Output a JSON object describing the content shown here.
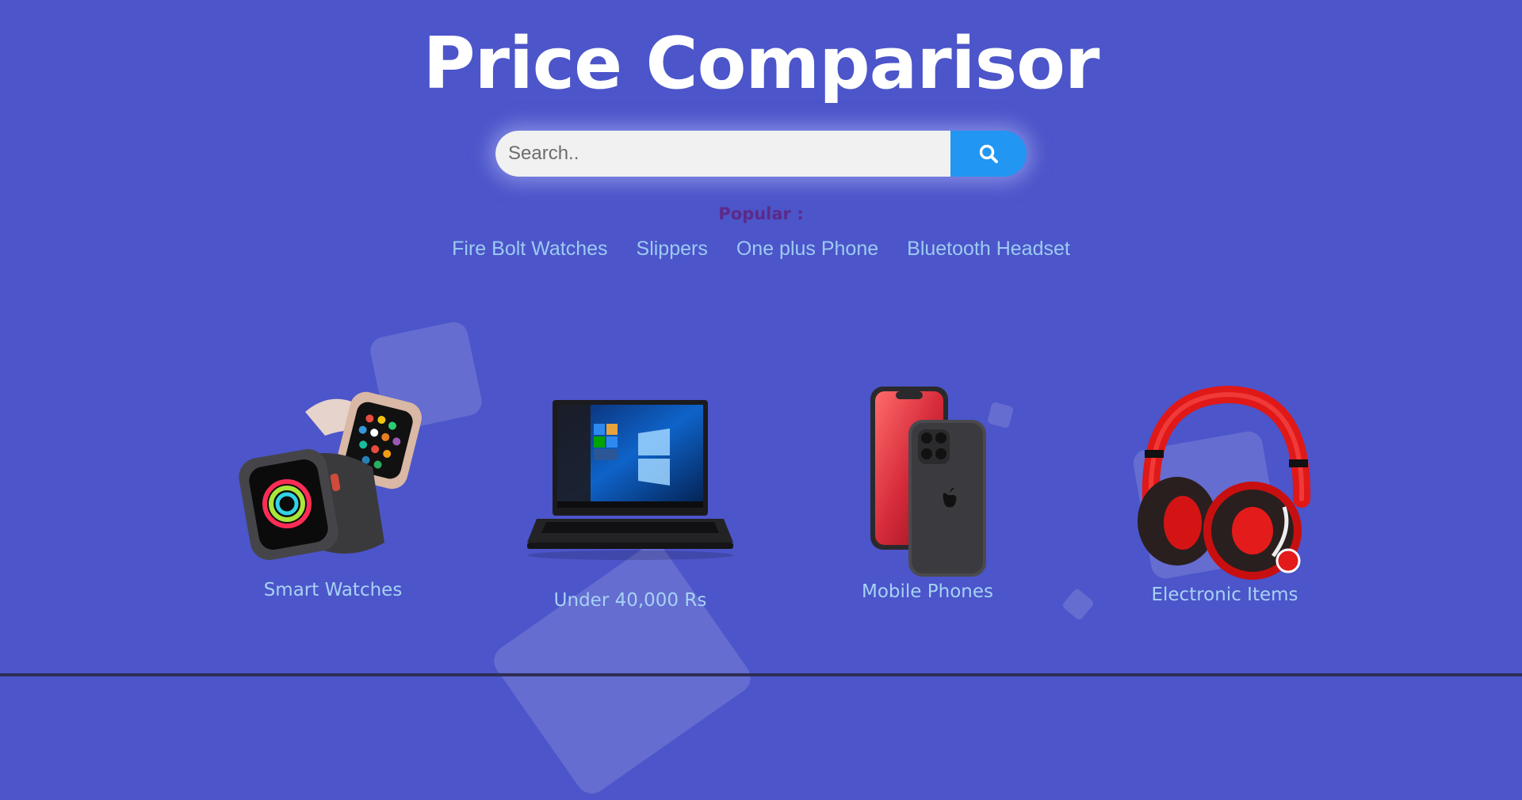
{
  "header": {
    "title": "Price Comparisor"
  },
  "search": {
    "placeholder": "Search..",
    "value": ""
  },
  "popular": {
    "label": "Popular :",
    "links": [
      "Fire Bolt Watches",
      "Slippers",
      "One plus Phone",
      "Bluetooth Headset"
    ]
  },
  "categories": [
    {
      "label": "Smart Watches",
      "icon": "smartwatch-image"
    },
    {
      "label": "Under 40,000 Rs",
      "icon": "laptop-image"
    },
    {
      "label": "Mobile Phones",
      "icon": "mobile-phone-image"
    },
    {
      "label": "Electronic Items",
      "icon": "headphones-image"
    }
  ],
  "colors": {
    "background": "#4c55c9",
    "search_button": "#2196f3",
    "link": "#9ccbf2",
    "popular_label": "#5c2a8a"
  }
}
